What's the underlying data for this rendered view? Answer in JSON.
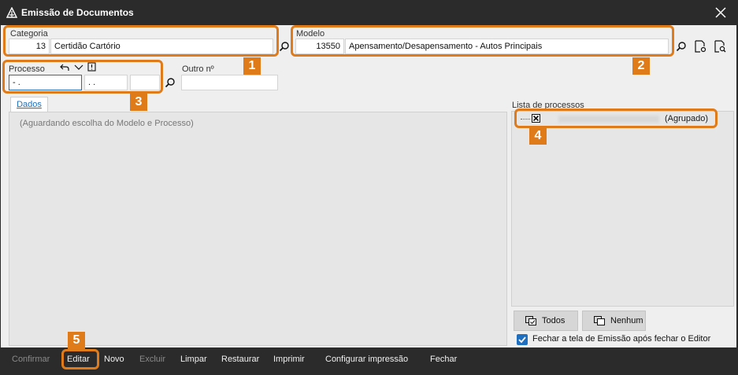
{
  "window": {
    "title": "Emissão de Documentos"
  },
  "categoria": {
    "label": "Categoria",
    "code": "13",
    "name": "Certidão Cartório"
  },
  "modelo": {
    "label": "Modelo",
    "code": "13550",
    "name": "Apensamento/Desapensamento - Autos Principais"
  },
  "processo": {
    "label": "Processo",
    "part1": "  -  .",
    "part2": ". .",
    "part3": ""
  },
  "outro": {
    "label": "Outro nº",
    "value": ""
  },
  "tabs": {
    "dados": "Dados"
  },
  "dados": {
    "hint": "(Aguardando escolha do Modelo e Processo)"
  },
  "lista": {
    "label": "Lista de processos",
    "item_suffix": "(Agrupado)"
  },
  "buttons": {
    "todos": "Todos",
    "nenhum": "Nenhum"
  },
  "fechar_tela": {
    "label": "Fechar a tela de Emissão após fechar o Editor",
    "checked": true
  },
  "badges": [
    "1",
    "2",
    "3",
    "4",
    "5"
  ],
  "bottom": {
    "confirmar": "Confirmar",
    "editar": "Editar",
    "novo": "Novo",
    "excluir": "Excluir",
    "limpar": "Limpar",
    "restaurar": "Restaurar",
    "imprimir": "Imprimir",
    "configurar": "Configurar impressão",
    "fechar": "Fechar"
  },
  "colors": {
    "accent": "#e07b1a",
    "link": "#1e6fbf",
    "dark": "#2b2b2b"
  }
}
